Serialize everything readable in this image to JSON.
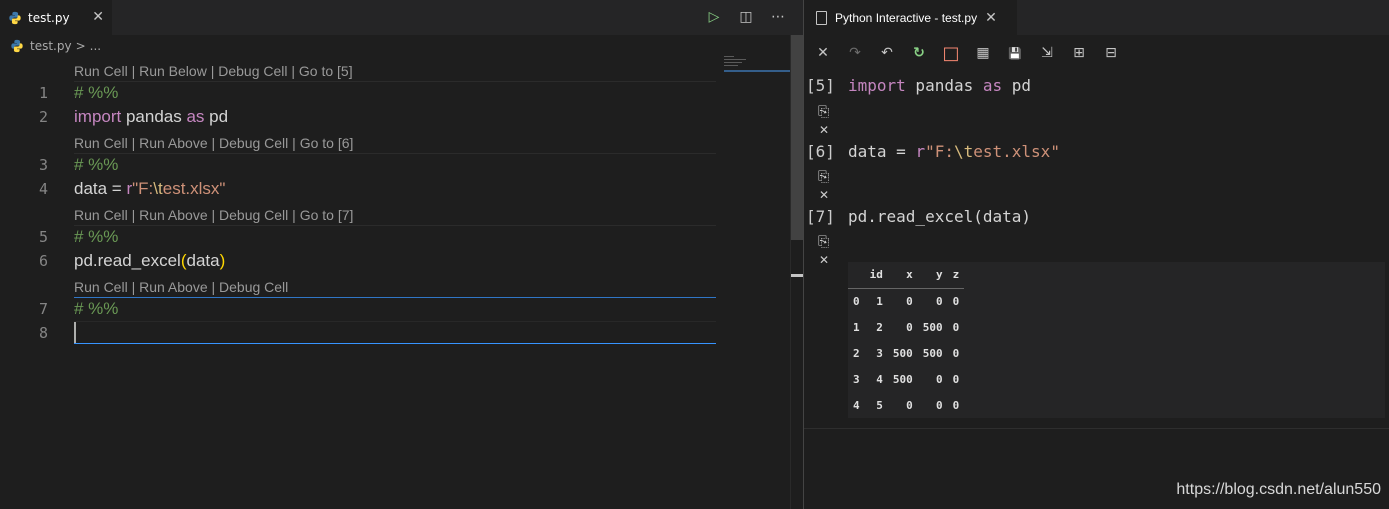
{
  "editor": {
    "tab": {
      "label": "test.py",
      "close": "✕"
    },
    "actions": {
      "run": "▷",
      "split": "◫",
      "more": "⋯"
    },
    "breadcrumb": {
      "file": "test.py",
      "separator": ">",
      "more": "..."
    },
    "codelens": [
      "Run Cell | Run Below | Debug Cell | Go to [5]",
      "Run Cell | Run Above | Debug Cell | Go to [6]",
      "Run Cell | Run Above | Debug Cell | Go to [7]",
      "Run Cell | Run Above | Debug Cell"
    ],
    "line_numbers": [
      "1",
      "2",
      "3",
      "4",
      "5",
      "6",
      "7",
      "8"
    ],
    "lines": {
      "l1": "# %%",
      "l2_kw1": "import",
      "l2_mod": " pandas ",
      "l2_kw2": "as",
      "l2_alias": " pd",
      "l3": "# %%",
      "l4_var": "data = ",
      "l4_prefix": "r",
      "l4_q1": "\"F:",
      "l4_esc": "\\t",
      "l4_rest": "est.xlsx\"",
      "l5": "# %%",
      "l6_call": "pd.read_excel",
      "l6_open": "(",
      "l6_arg": "data",
      "l6_close": ")",
      "l7": "# %%",
      "l8": ""
    }
  },
  "interactive": {
    "tab": {
      "label": "Python Interactive - test.py",
      "close": "✕"
    },
    "toolbar": {
      "clear": "✕",
      "redo": "↷",
      "undo": "↶",
      "restart": "↻",
      "interrupt": "□",
      "variables": "▦",
      "save": "💾",
      "export": "⇲",
      "expand": "⊞",
      "collapse": "⊟"
    },
    "cells": [
      {
        "prompt": "[5]",
        "kw1": "import",
        "mid": " pandas ",
        "kw2": "as",
        "tail": " pd"
      },
      {
        "prompt": "[6]",
        "var": "data = ",
        "prefix": "r",
        "str": "\"F:",
        "esc": "\\t",
        "rest": "est.xlsx\""
      },
      {
        "prompt": "[7]",
        "code": "pd.read_excel(data)"
      }
    ],
    "cell_icons": {
      "copy": "⎘",
      "delete": "✕"
    },
    "output_table": {
      "columns": [
        "",
        "id",
        "x",
        "y",
        "z"
      ],
      "rows": [
        [
          "0",
          "1",
          "0",
          "0",
          "0"
        ],
        [
          "1",
          "2",
          "0",
          "500",
          "0"
        ],
        [
          "2",
          "3",
          "500",
          "500",
          "0"
        ],
        [
          "3",
          "4",
          "500",
          "0",
          "0"
        ],
        [
          "4",
          "5",
          "0",
          "0",
          "0"
        ]
      ]
    }
  },
  "watermark": "https://blog.csdn.net/alun550",
  "colors": {
    "background": "#1e1e1e",
    "comment": "#6a9955",
    "keyword": "#c586c0",
    "string": "#ce9178",
    "escape": "#d7ba7d",
    "run_green": "#89d185",
    "interrupt_red": "#f48771",
    "accent_blue": "#3794ff"
  }
}
